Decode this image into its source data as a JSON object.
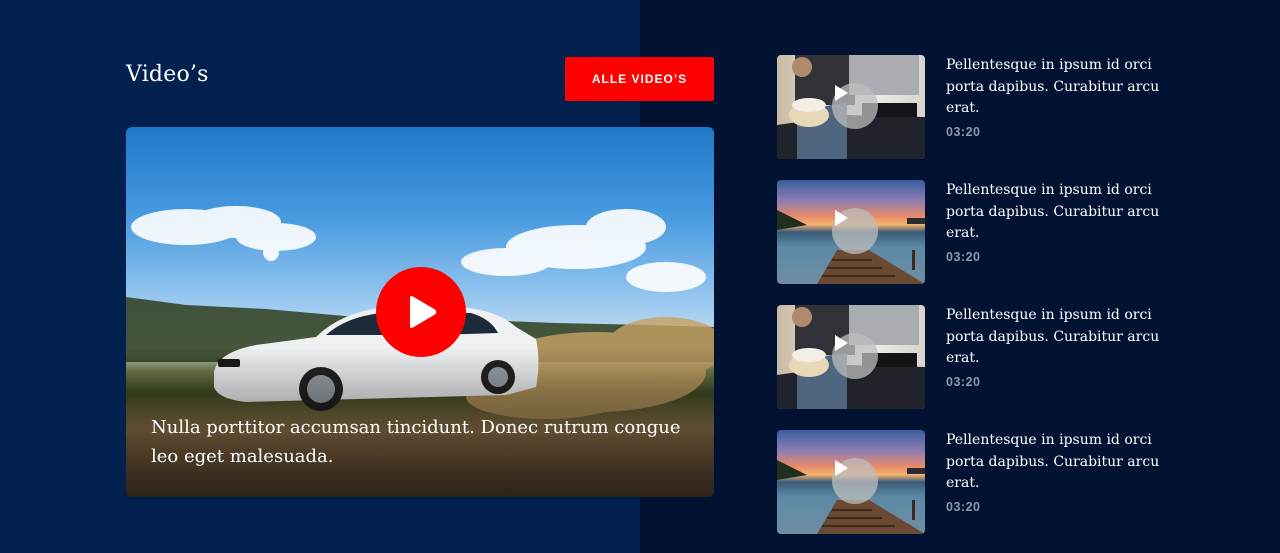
{
  "section": {
    "title": "Video’s",
    "all_button_label": "ALLE VIDEO’S"
  },
  "featured": {
    "caption": "Nulla porttitor accumsan tincidunt. Donec rutrum congue leo eget malesuada.",
    "play_icon": "play-icon",
    "accent_color": "#ff0000"
  },
  "playlist": [
    {
      "title": "Pellentesque in ipsum id orci porta dapibus. Curabitur arcu erat.",
      "duration": "03:20",
      "thumbnail": "couple-popcorn"
    },
    {
      "title": "Pellentesque in ipsum id orci porta dapibus. Curabitur arcu erat.",
      "duration": "03:20",
      "thumbnail": "sunset-pier"
    },
    {
      "title": "Pellentesque in ipsum id orci porta dapibus. Curabitur arcu erat.",
      "duration": "03:20",
      "thumbnail": "couple-popcorn"
    },
    {
      "title": "Pellentesque in ipsum id orci porta dapibus. Curabitur arcu erat.",
      "duration": "03:20",
      "thumbnail": "sunset-pier"
    }
  ],
  "colors": {
    "left_background": "#02214f",
    "right_background": "#011233",
    "button": "#ff0000",
    "duration_text": "#8e98ad"
  }
}
